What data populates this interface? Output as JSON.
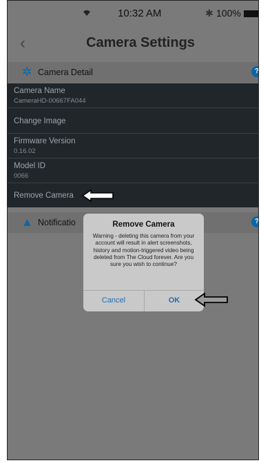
{
  "status_bar": {
    "wifi_icon": "wifi-icon",
    "time": "10:32 AM",
    "bluetooth_icon": "bluetooth-icon",
    "battery": "100%"
  },
  "nav": {
    "back_icon": "chevron-left-icon",
    "title": "Camera Settings"
  },
  "camera_detail": {
    "header": "Camera Detail",
    "rows": [
      {
        "label": "Camera Name",
        "value": "CameraHD-00667FA044"
      },
      {
        "label": "Change Image",
        "value": ""
      },
      {
        "label": "Firmware Version",
        "value": "0.16.02"
      },
      {
        "label": "Model ID",
        "value": "0066"
      },
      {
        "label": "Remove Camera",
        "value": ""
      }
    ]
  },
  "notifications": {
    "header": "Notificatio"
  },
  "dialog": {
    "title": "Remove Camera",
    "message": "Warning - deleting this camera from your account will result in alert screenshots, history and motion-triggered video being deleted from The Cloud forever. Are you sure you wish to continue?",
    "cancel_label": "Cancel",
    "ok_label": "OK"
  },
  "colors": {
    "accent": "#0a66a8",
    "dialog_button": "#1f6fb3",
    "dark_panel": "#20262a",
    "overlay": "#7a7a7a"
  }
}
